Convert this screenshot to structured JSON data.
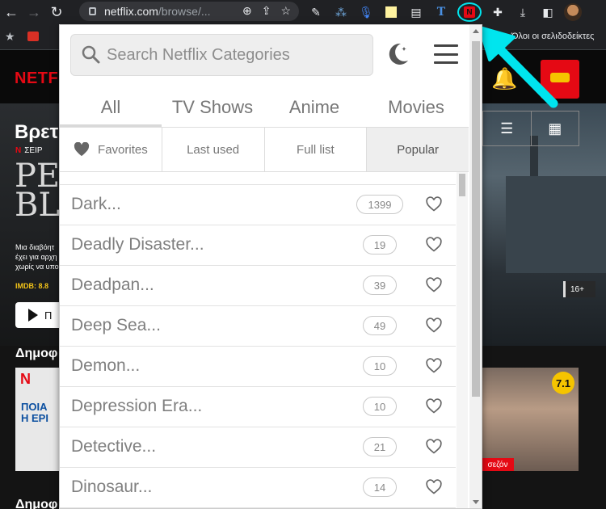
{
  "browser": {
    "url_host": "netflix.com",
    "url_path": "/browse/...",
    "bookmarks_other": "Όλοι οι σελιδοδείκτες"
  },
  "netflix": {
    "logo": "NETFLIX",
    "hero_title": "Βρετ",
    "hero_tag_series": "ΣΕΙΡ",
    "hero_logo_text": "PEA\nBLIN",
    "hero_description": "Μια διαβόητ\nέχει για αρχη\nχωρίς να υπο",
    "imdb": "IMDB: 8.8",
    "play_label": "Π",
    "row_title": "Δημοφ",
    "row_title_2": "Δημοφ",
    "card_left_text": "ΠΟΙΑ\nΗ ΕΡΙ",
    "age_rating": "16+",
    "card_right_rating": "7.1",
    "card_right_season": "σεζόν"
  },
  "popup": {
    "search_placeholder": "Search Netflix Categories",
    "category_tabs": [
      {
        "label": "All",
        "active": true
      },
      {
        "label": "TV Shows",
        "active": false
      },
      {
        "label": "Anime",
        "active": false
      },
      {
        "label": "Movies",
        "active": false
      }
    ],
    "sub_tabs": [
      {
        "label": "Favorites"
      },
      {
        "label": "Last used"
      },
      {
        "label": "Full list"
      },
      {
        "label": "Popular",
        "selected": true
      }
    ],
    "items": [
      {
        "name": "Dark...",
        "count": "1399"
      },
      {
        "name": "Deadly Disaster...",
        "count": "19"
      },
      {
        "name": "Deadpan...",
        "count": "39"
      },
      {
        "name": "Deep Sea...",
        "count": "49"
      },
      {
        "name": "Demon...",
        "count": "10"
      },
      {
        "name": "Depression Era...",
        "count": "10"
      },
      {
        "name": "Detective...",
        "count": "21"
      },
      {
        "name": "Dinosaur...",
        "count": "14"
      }
    ]
  },
  "colors": {
    "netflix_red": "#e50914",
    "annotation_cyan": "#00e5ee"
  }
}
